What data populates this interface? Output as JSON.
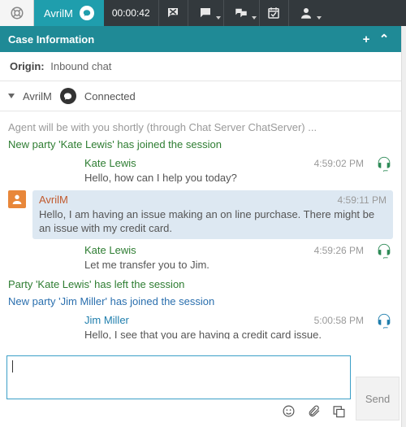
{
  "topbar": {
    "user": "AvrilM",
    "timer": "00:00:42"
  },
  "case": {
    "header": "Case Information",
    "origin_label": "Origin:",
    "origin_value": "Inbound chat"
  },
  "status": {
    "name": "AvrilM",
    "state": "Connected"
  },
  "chat": {
    "system": "Agent will be with you shortly (through Chat Server ChatServer) ...",
    "e1": "New party 'Kate Lewis' has joined the session",
    "m1": {
      "who": "Kate Lewis",
      "time": "4:59:02 PM",
      "txt": "Hello, how can I help you today?"
    },
    "m2": {
      "who": "AvrilM",
      "time": "4:59:11 PM",
      "txt": "Hello, I am having an issue making an on line purchase. There might be an issue with my credit card."
    },
    "m3": {
      "who": "Kate Lewis",
      "time": "4:59:26 PM",
      "txt": "Let me transfer you to Jim."
    },
    "e2": "Party 'Kate Lewis' has left the session",
    "e3": "New party 'Jim Miller' has joined the session",
    "m4": {
      "who": "Jim Miller",
      "time": "5:00:58 PM",
      "txt": "Hello, I see that you are having a credit card issue."
    }
  },
  "compose": {
    "send": "Send"
  }
}
